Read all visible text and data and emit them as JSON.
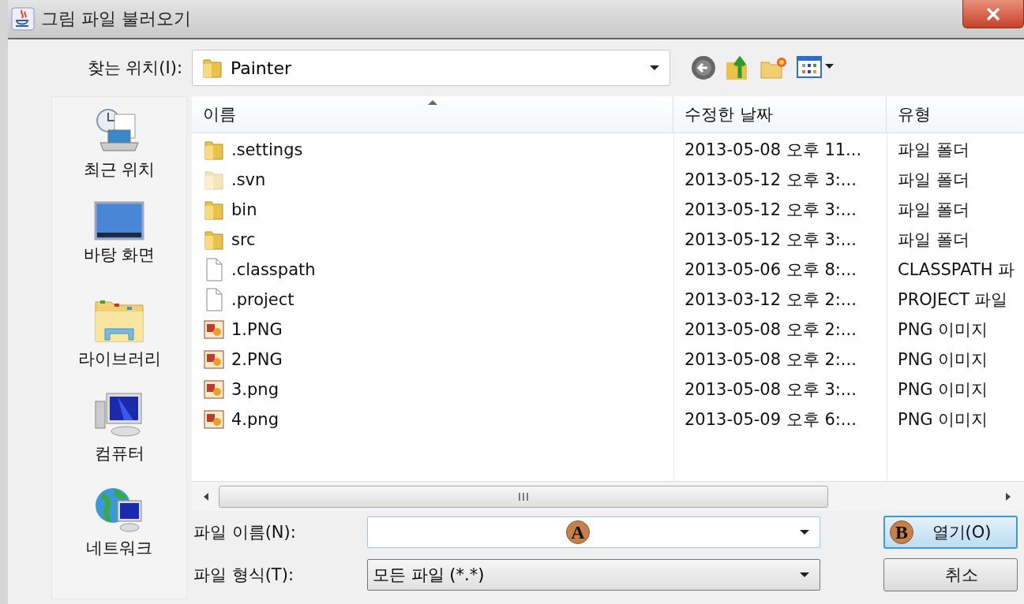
{
  "window": {
    "title": "그림 파일 불러오기"
  },
  "look_in": {
    "label": "찾는 위치(I):",
    "value": "Painter"
  },
  "places": [
    {
      "label": "최근 위치",
      "kind": "recent"
    },
    {
      "label": "바탕 화면",
      "kind": "desktop"
    },
    {
      "label": "라이브러리",
      "kind": "library"
    },
    {
      "label": "컴퓨터",
      "kind": "computer"
    },
    {
      "label": "네트워크",
      "kind": "network"
    }
  ],
  "table": {
    "columns": [
      {
        "label": "이름",
        "sorted": true
      },
      {
        "label": "수정한 날짜",
        "sorted": false
      },
      {
        "label": "유형",
        "sorted": false
      }
    ],
    "rows": [
      {
        "name": ".settings",
        "modified": "2013-05-08 오후 11...",
        "type": "파일 폴더",
        "kind": "folder"
      },
      {
        "name": ".svn",
        "modified": "2013-05-12 오후 3:...",
        "type": "파일 폴더",
        "kind": "hidden-folder"
      },
      {
        "name": "bin",
        "modified": "2013-05-12 오후 3:...",
        "type": "파일 폴더",
        "kind": "folder"
      },
      {
        "name": "src",
        "modified": "2013-05-12 오후 3:...",
        "type": "파일 폴더",
        "kind": "folder"
      },
      {
        "name": ".classpath",
        "modified": "2013-05-06 오후 8:...",
        "type": "CLASSPATH 파",
        "kind": "file"
      },
      {
        "name": ".project",
        "modified": "2013-03-12 오후 2:...",
        "type": "PROJECT 파일",
        "kind": "file"
      },
      {
        "name": "1.PNG",
        "modified": "2013-05-08 오후 2:...",
        "type": "PNG 이미지",
        "kind": "image"
      },
      {
        "name": "2.PNG",
        "modified": "2013-05-08 오후 2:...",
        "type": "PNG 이미지",
        "kind": "image"
      },
      {
        "name": "3.png",
        "modified": "2013-05-08 오후 3:...",
        "type": "PNG 이미지",
        "kind": "image"
      },
      {
        "name": "4.png",
        "modified": "2013-05-09 오후 6:...",
        "type": "PNG 이미지",
        "kind": "image"
      }
    ]
  },
  "file_name": {
    "label": "파일 이름(N):"
  },
  "file_type": {
    "label": "파일 형식(T):",
    "value": "모든 파일 (*.*)"
  },
  "buttons": [
    {
      "label": "열기(O)",
      "default": true
    },
    {
      "label": "취소",
      "default": false
    }
  ],
  "annotations": [
    {
      "label": "A"
    },
    {
      "label": "B"
    }
  ]
}
